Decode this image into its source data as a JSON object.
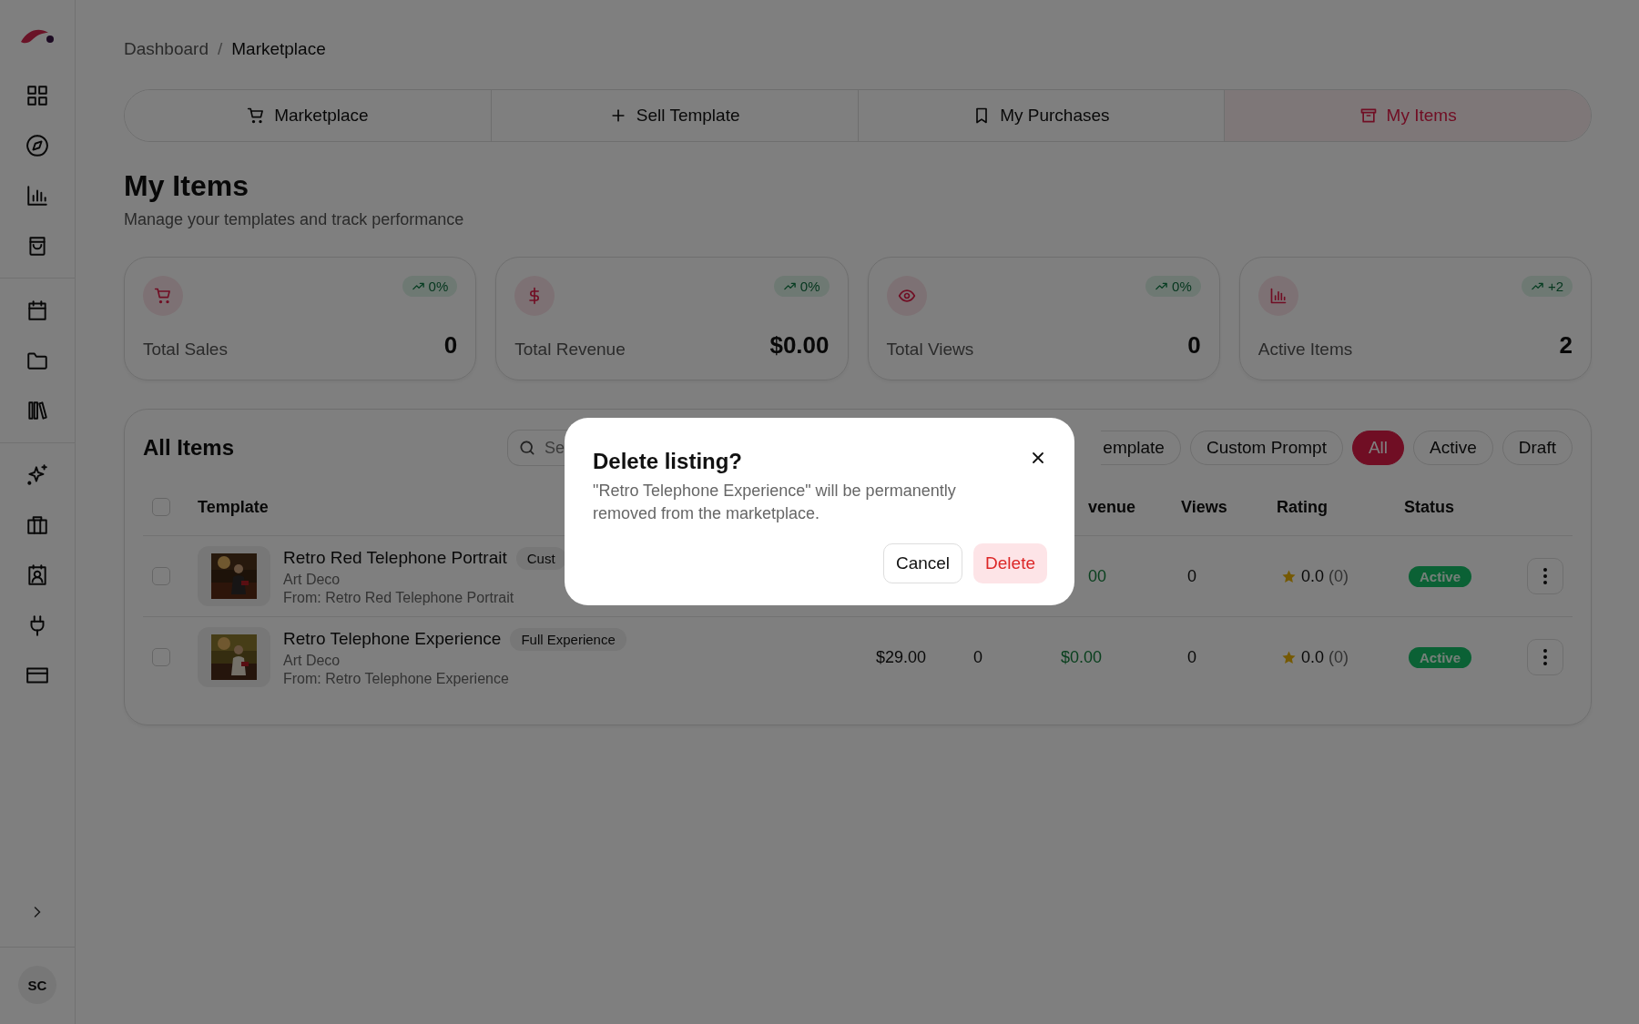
{
  "breadcrumb": {
    "items": [
      "Dashboard",
      "Marketplace"
    ],
    "separator": "/"
  },
  "tabs": [
    {
      "label": "Marketplace",
      "selected": false
    },
    {
      "label": "Sell Template",
      "selected": false
    },
    {
      "label": "My Purchases",
      "selected": false
    },
    {
      "label": "My Items",
      "selected": true
    }
  ],
  "page": {
    "title": "My Items",
    "subtitle": "Manage your templates and track performance"
  },
  "stats": [
    {
      "label": "Total Sales",
      "value": "0",
      "trend": "0%"
    },
    {
      "label": "Total Revenue",
      "value": "$0.00",
      "trend": "0%"
    },
    {
      "label": "Total Views",
      "value": "0",
      "trend": "0%"
    },
    {
      "label": "Active Items",
      "value": "2",
      "trend": "+2"
    }
  ],
  "items_panel": {
    "title": "All Items",
    "search": {
      "placeholder": "Se"
    },
    "filters": [
      {
        "label": "emplate",
        "selected": false,
        "kind": "partial"
      },
      {
        "label": "Custom Prompt",
        "selected": false,
        "kind": "full"
      },
      {
        "label": "All",
        "selected": true,
        "kind": "full"
      },
      {
        "label": "Active",
        "selected": false,
        "kind": "full"
      },
      {
        "label": "Draft",
        "selected": false,
        "kind": "full"
      }
    ],
    "select_all": {
      "checked": false
    },
    "columns": [
      {
        "label": "Template",
        "kind": "template"
      },
      {
        "label": "venue",
        "kind": "revenue"
      },
      {
        "label": "Views",
        "kind": "views"
      },
      {
        "label": "Rating",
        "kind": "rating"
      },
      {
        "label": "Status",
        "kind": "status"
      }
    ],
    "rows": [
      {
        "checked": false,
        "name": "Retro Red Telephone Portrait",
        "tag": "Cust",
        "style": "Art Deco",
        "source": "From: Retro Red Telephone Portrait",
        "revenue": "00",
        "views": "0",
        "rating": "0.0",
        "reviews": "(0)",
        "status": "Active"
      },
      {
        "checked": false,
        "name": "Retro Telephone Experience",
        "tag": "Full Experience",
        "style": "Art Deco",
        "source": "From: Retro Telephone Experience",
        "price": "$29.00",
        "sales": "0",
        "revenue": "$0.00",
        "views": "0",
        "rating": "0.0",
        "reviews": "(0)",
        "status": "Active"
      }
    ]
  },
  "user": {
    "initials": "SC"
  },
  "dialog": {
    "title": "Delete listing?",
    "message": "\"Retro Telephone Experience\" will be permanently removed from the marketplace.",
    "buttons": [
      {
        "label": "Cancel",
        "kind": "secondary"
      },
      {
        "label": "Delete",
        "kind": "danger"
      }
    ]
  }
}
